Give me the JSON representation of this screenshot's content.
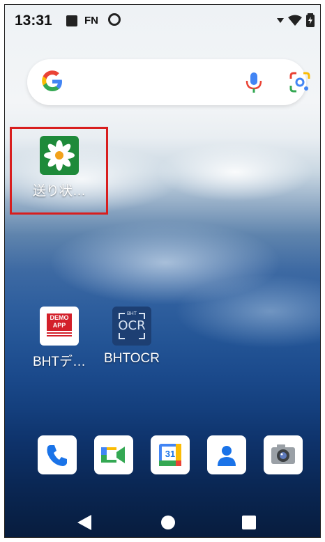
{
  "status_bar": {
    "time": "13:31",
    "fn_label": "FN"
  },
  "search_bar": {
    "google_logo": "google-g-logo",
    "mic": "mic-icon",
    "lens": "lens-icon"
  },
  "home_apps": [
    {
      "label": "送り状…",
      "icon": "daisy-flower-icon",
      "highlighted": true
    },
    {
      "label": "BHTデ…",
      "icon": "demo-app-icon",
      "tile_text": "DEMO APP"
    },
    {
      "label": "BHTOCR",
      "icon": "bht-ocr-icon",
      "tile_text": "OCR",
      "tile_subtext": "BHT"
    }
  ],
  "dock": [
    "phone-icon",
    "meet-icon",
    "calendar-icon",
    "contacts-icon",
    "camera-icon"
  ],
  "calendar_day": "31",
  "nav_bar": [
    "back-button",
    "home-button",
    "recents-button"
  ],
  "colors": {
    "highlight": "#d81e1e",
    "app_green": "#1e8a3a",
    "demo_red": "#d3202a",
    "ocr_blue": "#1d3f73"
  }
}
